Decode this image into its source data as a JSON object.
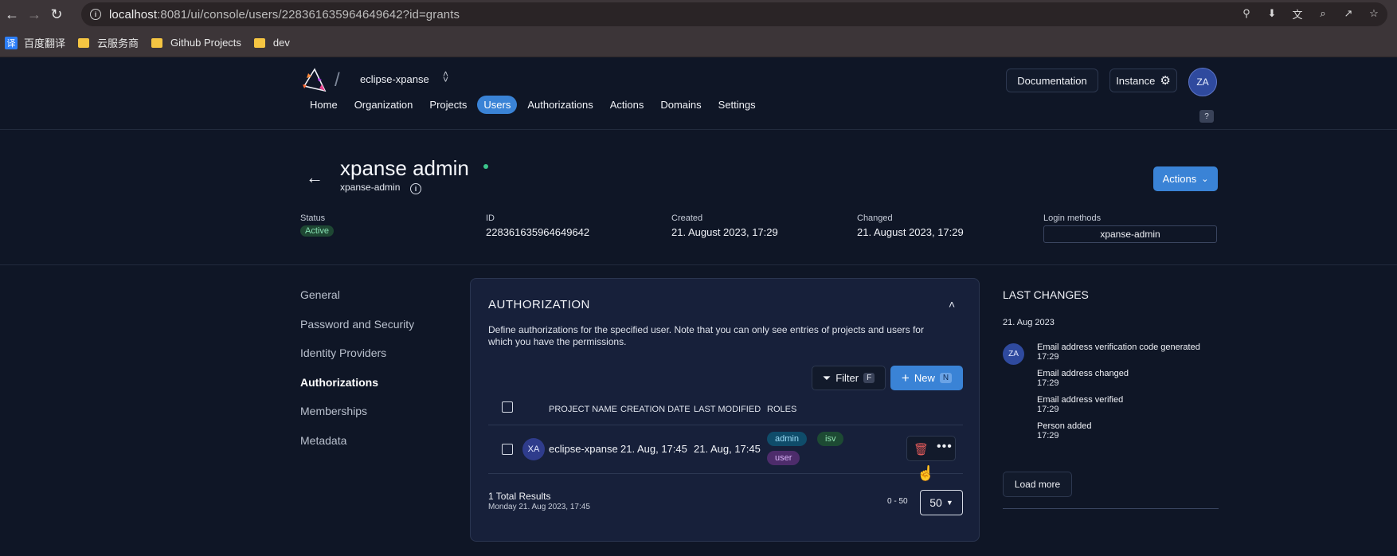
{
  "browser": {
    "url_host": "localhost",
    "url_rest": ":8081/ui/console/users/228361635964649642?id=grants",
    "bookmarks": [
      "百度翻译",
      "云服务商",
      "Github Projects",
      "dev"
    ],
    "bookmark_icon_char": "译"
  },
  "header": {
    "org_name": "eclipse-xpanse",
    "documentation_label": "Documentation",
    "instance_label": "Instance",
    "avatar_initials": "ZA",
    "help_label": "?",
    "nav_tabs": [
      {
        "label": "Home",
        "active": false
      },
      {
        "label": "Organization",
        "active": false
      },
      {
        "label": "Projects",
        "active": false
      },
      {
        "label": "Users",
        "active": true
      },
      {
        "label": "Authorizations",
        "active": false
      },
      {
        "label": "Actions",
        "active": false
      },
      {
        "label": "Domains",
        "active": false
      },
      {
        "label": "Settings",
        "active": false
      }
    ]
  },
  "user": {
    "display_name": "xpanse admin",
    "login_name": "xpanse-admin",
    "actions_label": "Actions",
    "status_label": "Status",
    "status_value": "Active",
    "id_label": "ID",
    "id_value": "228361635964649642",
    "created_label": "Created",
    "created_value": "21. August 2023, 17:29",
    "changed_label": "Changed",
    "changed_value": "21. August 2023, 17:29",
    "login_methods_label": "Login methods",
    "login_methods_value": "xpanse-admin"
  },
  "side_nav": [
    "General",
    "Password and Security",
    "Identity Providers",
    "Authorizations",
    "Memberships",
    "Metadata"
  ],
  "side_nav_active": "Authorizations",
  "authorization": {
    "title": "AUTHORIZATION",
    "description": "Define authorizations for the specified user. Note that you can only see entries of projects and users for which you have the permissions.",
    "filter_label": "Filter",
    "filter_key": "F",
    "new_label": "New",
    "new_key": "N",
    "columns": [
      "PROJECT NAME",
      "CREATION DATE",
      "LAST MODIFIED",
      "ROLES"
    ],
    "rows": [
      {
        "avatar": "XA",
        "project_name": "eclipse-xpanse",
        "creation_date": "21. Aug, 17:45",
        "last_modified": "21. Aug, 17:45",
        "roles": [
          "admin",
          "isv",
          "user"
        ]
      }
    ],
    "total_results": "1 Total Results",
    "total_date": "Monday 21. Aug 2023, 17:45",
    "range": "0 - 50",
    "page_size": "50"
  },
  "last_changes": {
    "title": "LAST CHANGES",
    "date": "21. Aug 2023",
    "avatar": "ZA",
    "entries": [
      {
        "text": "Email address verification code generated",
        "time": "17:29"
      },
      {
        "text": "Email address changed",
        "time": "17:29"
      },
      {
        "text": "Email address verified",
        "time": "17:29"
      },
      {
        "text": "Person added",
        "time": "17:29"
      }
    ],
    "load_more_label": "Load more"
  }
}
